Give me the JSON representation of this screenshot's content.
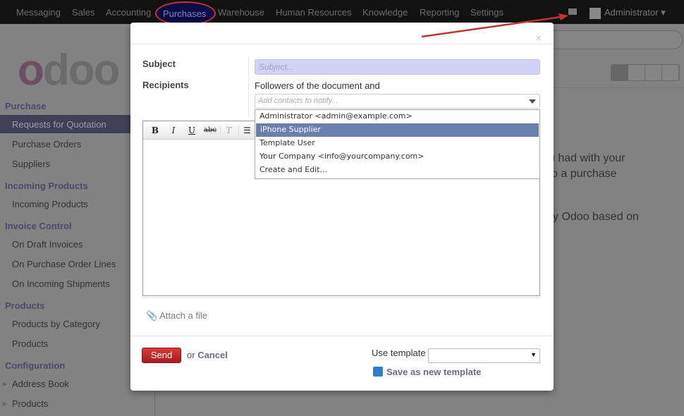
{
  "topnav": {
    "items": [
      "Messaging",
      "Sales",
      "Accounting",
      "Purchases",
      "Warehouse",
      "Human Resources",
      "Knowledge",
      "Reporting",
      "Settings"
    ],
    "active": "Purchases",
    "user": "Administrator"
  },
  "logo": "odoo",
  "sidebar": {
    "purchase": "Purchase",
    "rfq": "Requests for Quotation",
    "po": "Purchase Orders",
    "suppliers": "Suppliers",
    "incoming": "Incoming Products",
    "incoming_item": "Incoming Products",
    "invoice": "Invoice Control",
    "draft": "On Draft Invoices",
    "pol": "On Purchase Order Lines",
    "ship": "On Incoming Shipments",
    "products": "Products",
    "bycat": "Products by Category",
    "products_item": "Products",
    "config": "Configuration",
    "address": "Address Book",
    "products_cfg": "Products"
  },
  "main": {
    "line1": "u had with your",
    "line2": "o a purchase",
    "line3": "y Odoo based on"
  },
  "modal": {
    "close": "×",
    "subject_label": "Subject",
    "subject_placeholder": "Subject...",
    "recipients_label": "Recipients",
    "followers": "Followers of the document and",
    "contacts_placeholder": "Add contacts to notify...",
    "options": [
      "Administrator <admin@example.com>",
      "iPhone Supplier",
      "Template User",
      "Your Company <info@yourcompany.com>",
      "Create and Edit..."
    ],
    "highlighted_option": "iPhone Supplier",
    "attach": "Attach a file",
    "send": "Send",
    "or": "or",
    "cancel": "Cancel",
    "use_template": "Use template",
    "template_value": "",
    "save_template": "Save as new template"
  },
  "colors": {
    "annotation": "#c0352b",
    "highlight": "#6b7fae",
    "send": "#c62828"
  }
}
